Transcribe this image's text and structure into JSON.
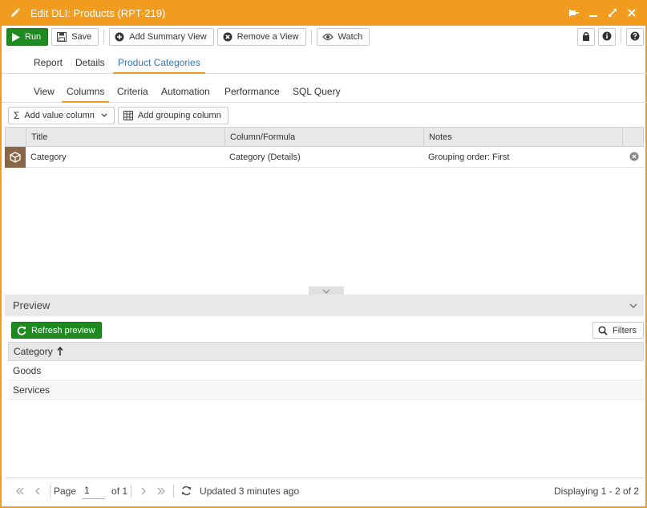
{
  "window": {
    "title": "Edit DLI: Products (RPT-219)",
    "accent_color": "#f29c1f",
    "icons": [
      "pin-icon",
      "minimize-icon",
      "maximize-icon",
      "close-icon"
    ]
  },
  "toolbar": {
    "run_label": "Run",
    "save_label": "Save",
    "add_summary_label": "Add Summary View",
    "remove_view_label": "Remove a View",
    "watch_label": "Watch"
  },
  "tabs_top": [
    {
      "label": "Report"
    },
    {
      "label": "Details"
    },
    {
      "label": "Product Categories",
      "active": true
    }
  ],
  "tabs_sub": [
    {
      "label": "View"
    },
    {
      "label": "Columns",
      "active": true
    },
    {
      "label": "Criteria"
    },
    {
      "label": "Automation"
    },
    {
      "label": "Performance"
    },
    {
      "label": "SQL Query"
    }
  ],
  "column_actions": {
    "add_value_label": "Add value column",
    "add_grouping_label": "Add grouping column"
  },
  "grid": {
    "headers": [
      "Title",
      "Column/Formula",
      "Notes"
    ],
    "rows": [
      {
        "title": "Category",
        "formula": "Category (Details)",
        "notes": "Grouping order: First"
      }
    ]
  },
  "preview": {
    "title": "Preview",
    "refresh_label": "Refresh preview",
    "filters_label": "Filters",
    "column_header": "Category",
    "rows": [
      "Goods",
      "Services"
    ]
  },
  "pager": {
    "page_label": "Page",
    "page_value": "1",
    "of_label": "of 1",
    "updated": "Updated 3 minutes ago",
    "displaying": "Displaying 1 - 2 of 2"
  }
}
